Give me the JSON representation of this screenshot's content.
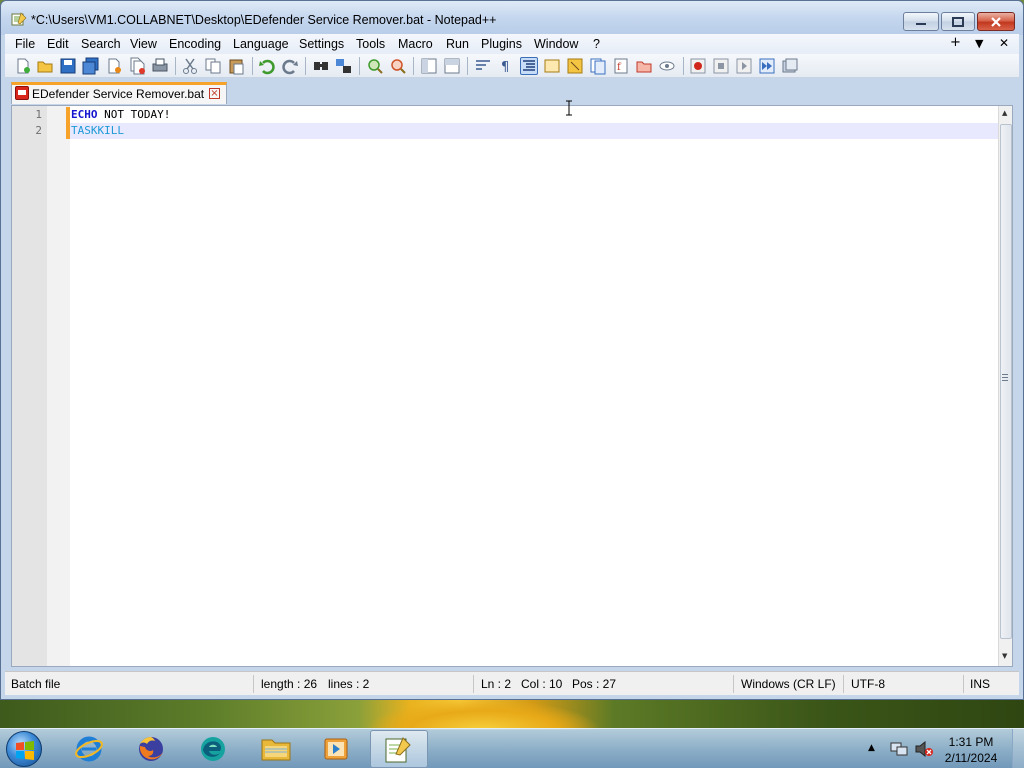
{
  "window": {
    "title": "*C:\\Users\\VM1.COLLABNET\\Desktop\\EDefender Service Remover.bat - Notepad++"
  },
  "menu": {
    "items": [
      "File",
      "Edit",
      "Search",
      "View",
      "Encoding",
      "Language",
      "Settings",
      "Tools",
      "Macro",
      "Run",
      "Plugins",
      "Window",
      "?"
    ],
    "right": [
      "+",
      "▼",
      "✕"
    ]
  },
  "toolbar": {
    "icons": [
      "new-file-icon",
      "open-file-icon",
      "save-icon",
      "save-all-icon",
      "close-icon",
      "close-all-icon",
      "print-icon",
      "cut-icon",
      "copy-icon",
      "paste-icon",
      "undo-icon",
      "redo-icon",
      "find-icon",
      "replace-icon",
      "zoom-in-icon",
      "zoom-out-icon",
      "sync-vertical-icon",
      "sync-horizontal-icon",
      "word-wrap-icon",
      "show-all-chars-icon",
      "indent-guide-icon",
      "udl-icon",
      "doc-map-icon",
      "doc-list-icon",
      "function-list-icon",
      "folder-workspace-icon",
      "monitoring-icon",
      "record-macro-icon",
      "stop-record-icon",
      "playback-macro-icon",
      "run-macro-multiple-icon",
      "save-macro-icon"
    ]
  },
  "tab": {
    "label": "EDefender Service Remover.bat"
  },
  "editor": {
    "lines": [
      {
        "num": "1",
        "keyword": "ECHO",
        "rest": " NOT TODAY!"
      },
      {
        "num": "2",
        "keyword": "",
        "rest": "TASKKILL"
      }
    ]
  },
  "status": {
    "file_type": "Batch file",
    "length": "length : 26",
    "lines": "lines : 2",
    "ln": "Ln : 2",
    "col": "Col : 10",
    "pos": "Pos : 27",
    "eol": "Windows (CR LF)",
    "encoding": "UTF-8",
    "mode": "INS"
  },
  "taskbar": {
    "time": "1:31 PM",
    "date": "2/11/2024"
  },
  "colors": {
    "keyword": "#1515d0",
    "command": "#1e9ad6",
    "change_marker": "#f7a329",
    "current_line": "#e8e8ff"
  }
}
